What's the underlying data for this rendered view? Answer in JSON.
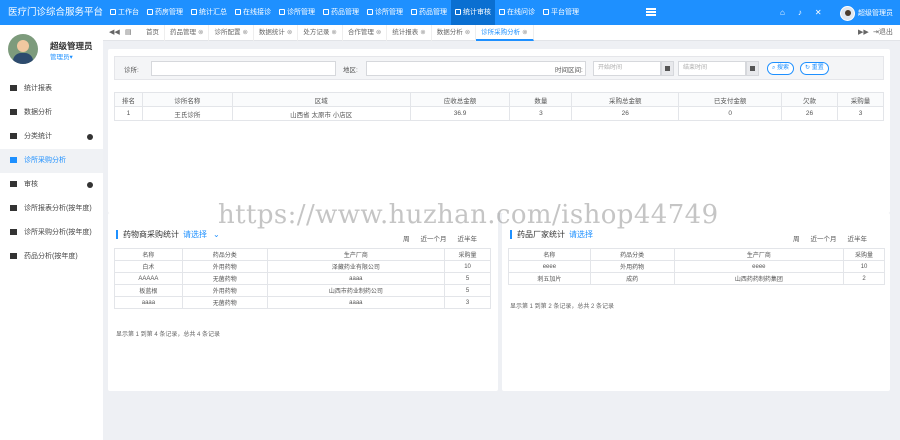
{
  "app": {
    "title": "医疗门诊综合服务平台"
  },
  "topnav": [
    {
      "label": "工作台",
      "icon": "home-icon"
    },
    {
      "label": "药房管理",
      "icon": "pill-icon"
    },
    {
      "label": "统计汇总",
      "icon": "dollar-icon"
    },
    {
      "label": "在线接诊",
      "icon": "phone-icon"
    },
    {
      "label": "诊所管理",
      "icon": "clinic-icon"
    },
    {
      "label": "药品管理",
      "icon": "box-icon"
    },
    {
      "label": "诊所管理",
      "icon": "hospital-icon"
    },
    {
      "label": "药品管理",
      "icon": "medicine-icon"
    },
    {
      "label": "统计审核",
      "icon": "chart-icon"
    },
    {
      "label": "在线问诊",
      "icon": "chat-icon"
    },
    {
      "label": "平台管理",
      "icon": "settings-icon"
    }
  ],
  "topnav_active": 8,
  "user": {
    "name": "超级管理员",
    "role": "管理员",
    "top_label": "超级管理员"
  },
  "topright_icons": [
    "home-icon",
    "bell-icon",
    "close-icon"
  ],
  "sidebar": [
    {
      "label": "统计报表",
      "icon": "grid-icon",
      "arrow": false
    },
    {
      "label": "数据分析",
      "icon": "star-icon",
      "arrow": false
    },
    {
      "label": "分类统计",
      "icon": "flask-icon",
      "arrow": true
    },
    {
      "label": "诊所采购分析",
      "icon": "list-icon",
      "arrow": false,
      "active": true
    },
    {
      "label": "审核",
      "icon": "edit-icon",
      "arrow": true
    },
    {
      "label": "诊所报表分析(按年度)",
      "icon": "table-icon",
      "arrow": false
    },
    {
      "label": "诊所采购分析(按年度)",
      "icon": "table-icon",
      "arrow": false
    },
    {
      "label": "药品分析(按年度)",
      "icon": "table-icon",
      "arrow": false
    }
  ],
  "tabbar": {
    "home": "首页",
    "exit": "退出",
    "tabs": [
      "药品管理",
      "诊所配置",
      "数据统计",
      "处方记录",
      "合作管理",
      "统计报表",
      "数据分析",
      "诊所采购分析"
    ],
    "active": 7
  },
  "search": {
    "clinic_label": "诊所:",
    "area_label": "地区:",
    "time_label": "时间区间:",
    "start_placeholder": "开始时间",
    "end_placeholder": "结束时间",
    "search_btn": "搜索",
    "reset_btn": "重置"
  },
  "main_table": {
    "headers": [
      "排名",
      "诊所名称",
      "区域",
      "应收总金额",
      "数量",
      "采购总金额",
      "已支付金额",
      "欠款",
      "采购量"
    ],
    "rows": [
      [
        "1",
        "王氏诊所",
        "山西省 太原市 小店区",
        "36.9",
        "3",
        "26",
        "0",
        "26",
        "3"
      ]
    ]
  },
  "left_panel": {
    "title": "药物商采购统计",
    "select": "请选择",
    "filters": [
      "周",
      "近一个月",
      "近半年"
    ],
    "headers": [
      "名称",
      "药品分类",
      "生产厂商",
      "采购量"
    ],
    "rows": [
      [
        "白术",
        "外用药物",
        "泽藏药业有限公司",
        "10"
      ],
      [
        "AAAAA",
        "无菌药物",
        "aaaa",
        "5"
      ],
      [
        "板蓝根",
        "外用药物",
        "山西市药业制药公司",
        "5"
      ],
      [
        "aaaa",
        "无菌药物",
        "aaaa",
        "3"
      ]
    ],
    "info": "显示第 1 到第 4 条记录，总共 4 条记录"
  },
  "right_panel": {
    "title": "药品厂家统计",
    "select": "请选择",
    "filters": [
      "周",
      "近一个月",
      "近半年"
    ],
    "headers": [
      "名称",
      "药品分类",
      "生产厂商",
      "采购量"
    ],
    "rows": [
      [
        "eeee",
        "外用药物",
        "eeee",
        "10"
      ],
      [
        "刺五加片",
        "成药",
        "山西药药制药集团",
        "2"
      ]
    ],
    "info": "显示第 1 到第 2 条记录，总共 2 条记录"
  },
  "watermark": "https://www.huzhan.com/ishop44749"
}
